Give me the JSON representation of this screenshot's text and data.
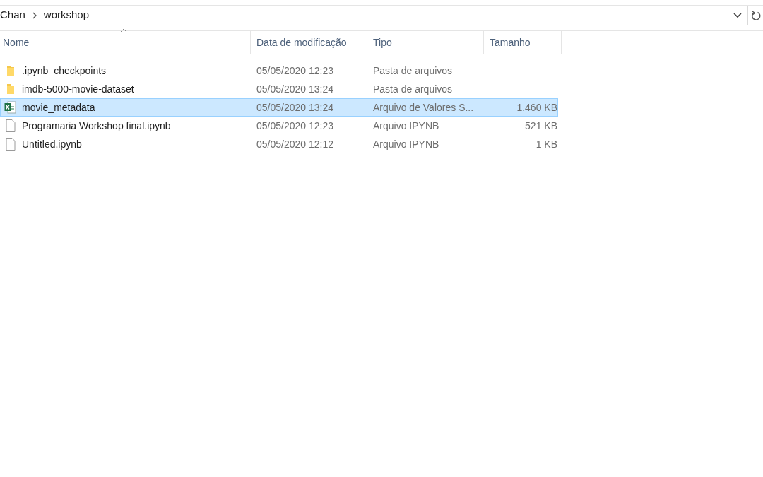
{
  "address_bar": {
    "path": [
      "Chan",
      "workshop"
    ]
  },
  "table": {
    "columns": [
      "Nome",
      "Data de modificação",
      "Tipo",
      "Tamanho"
    ],
    "rows": [
      {
        "kind": "folder",
        "name": ".ipynb_checkpoints",
        "modified": "05/05/2020 12:23",
        "type": "Pasta de arquivos",
        "selected": false
      },
      {
        "kind": "folder",
        "name": "imdb-5000-movie-dataset",
        "modified": "05/05/2020 13:24",
        "type": "Pasta de arquivos",
        "selected": false
      },
      {
        "kind": "spreadsheet",
        "name": "movie_metadata",
        "modified": "05/05/2020 13:24",
        "type": "Arquivo de Valores S...",
        "size": "1.460 KB",
        "selected": true
      },
      {
        "kind": "file",
        "name": "Programaria Workshop final.ipynb",
        "modified": "05/05/2020 12:23",
        "type": "Arquivo IPYNB",
        "size": "521 KB",
        "selected": false
      },
      {
        "kind": "file",
        "name": "Untitled.ipynb",
        "modified": "05/05/2020 12:12",
        "type": "Arquivo IPYNB",
        "size": "1 KB",
        "selected": false
      }
    ]
  }
}
